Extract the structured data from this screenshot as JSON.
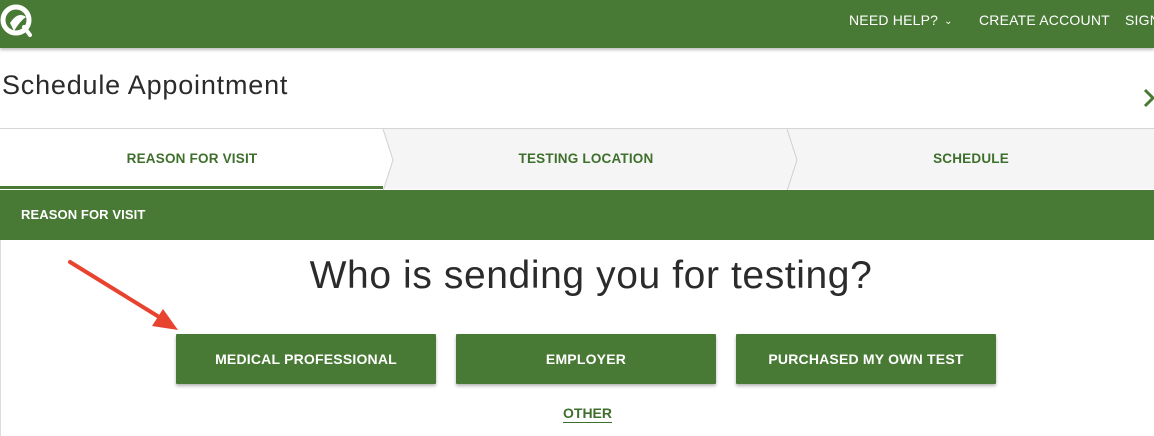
{
  "header": {
    "nav_help": "NEED HELP?",
    "nav_create": "CREATE ACCOUNT",
    "nav_sign": "SIGN",
    "brand_color": "#497a35"
  },
  "page": {
    "title": "Schedule Appointment"
  },
  "steps": [
    {
      "label": "REASON FOR VISIT",
      "active": true
    },
    {
      "label": "TESTING LOCATION",
      "active": false
    },
    {
      "label": "SCHEDULE",
      "active": false
    }
  ],
  "section": {
    "title": "REASON FOR VISIT",
    "question": "Who is sending you for testing?",
    "options": [
      {
        "label": "MEDICAL PROFESSIONAL"
      },
      {
        "label": "EMPLOYER"
      },
      {
        "label": "PURCHASED MY OWN TEST"
      }
    ],
    "other_link": "OTHER"
  },
  "annotation": {
    "arrow_color": "#e8432e"
  }
}
